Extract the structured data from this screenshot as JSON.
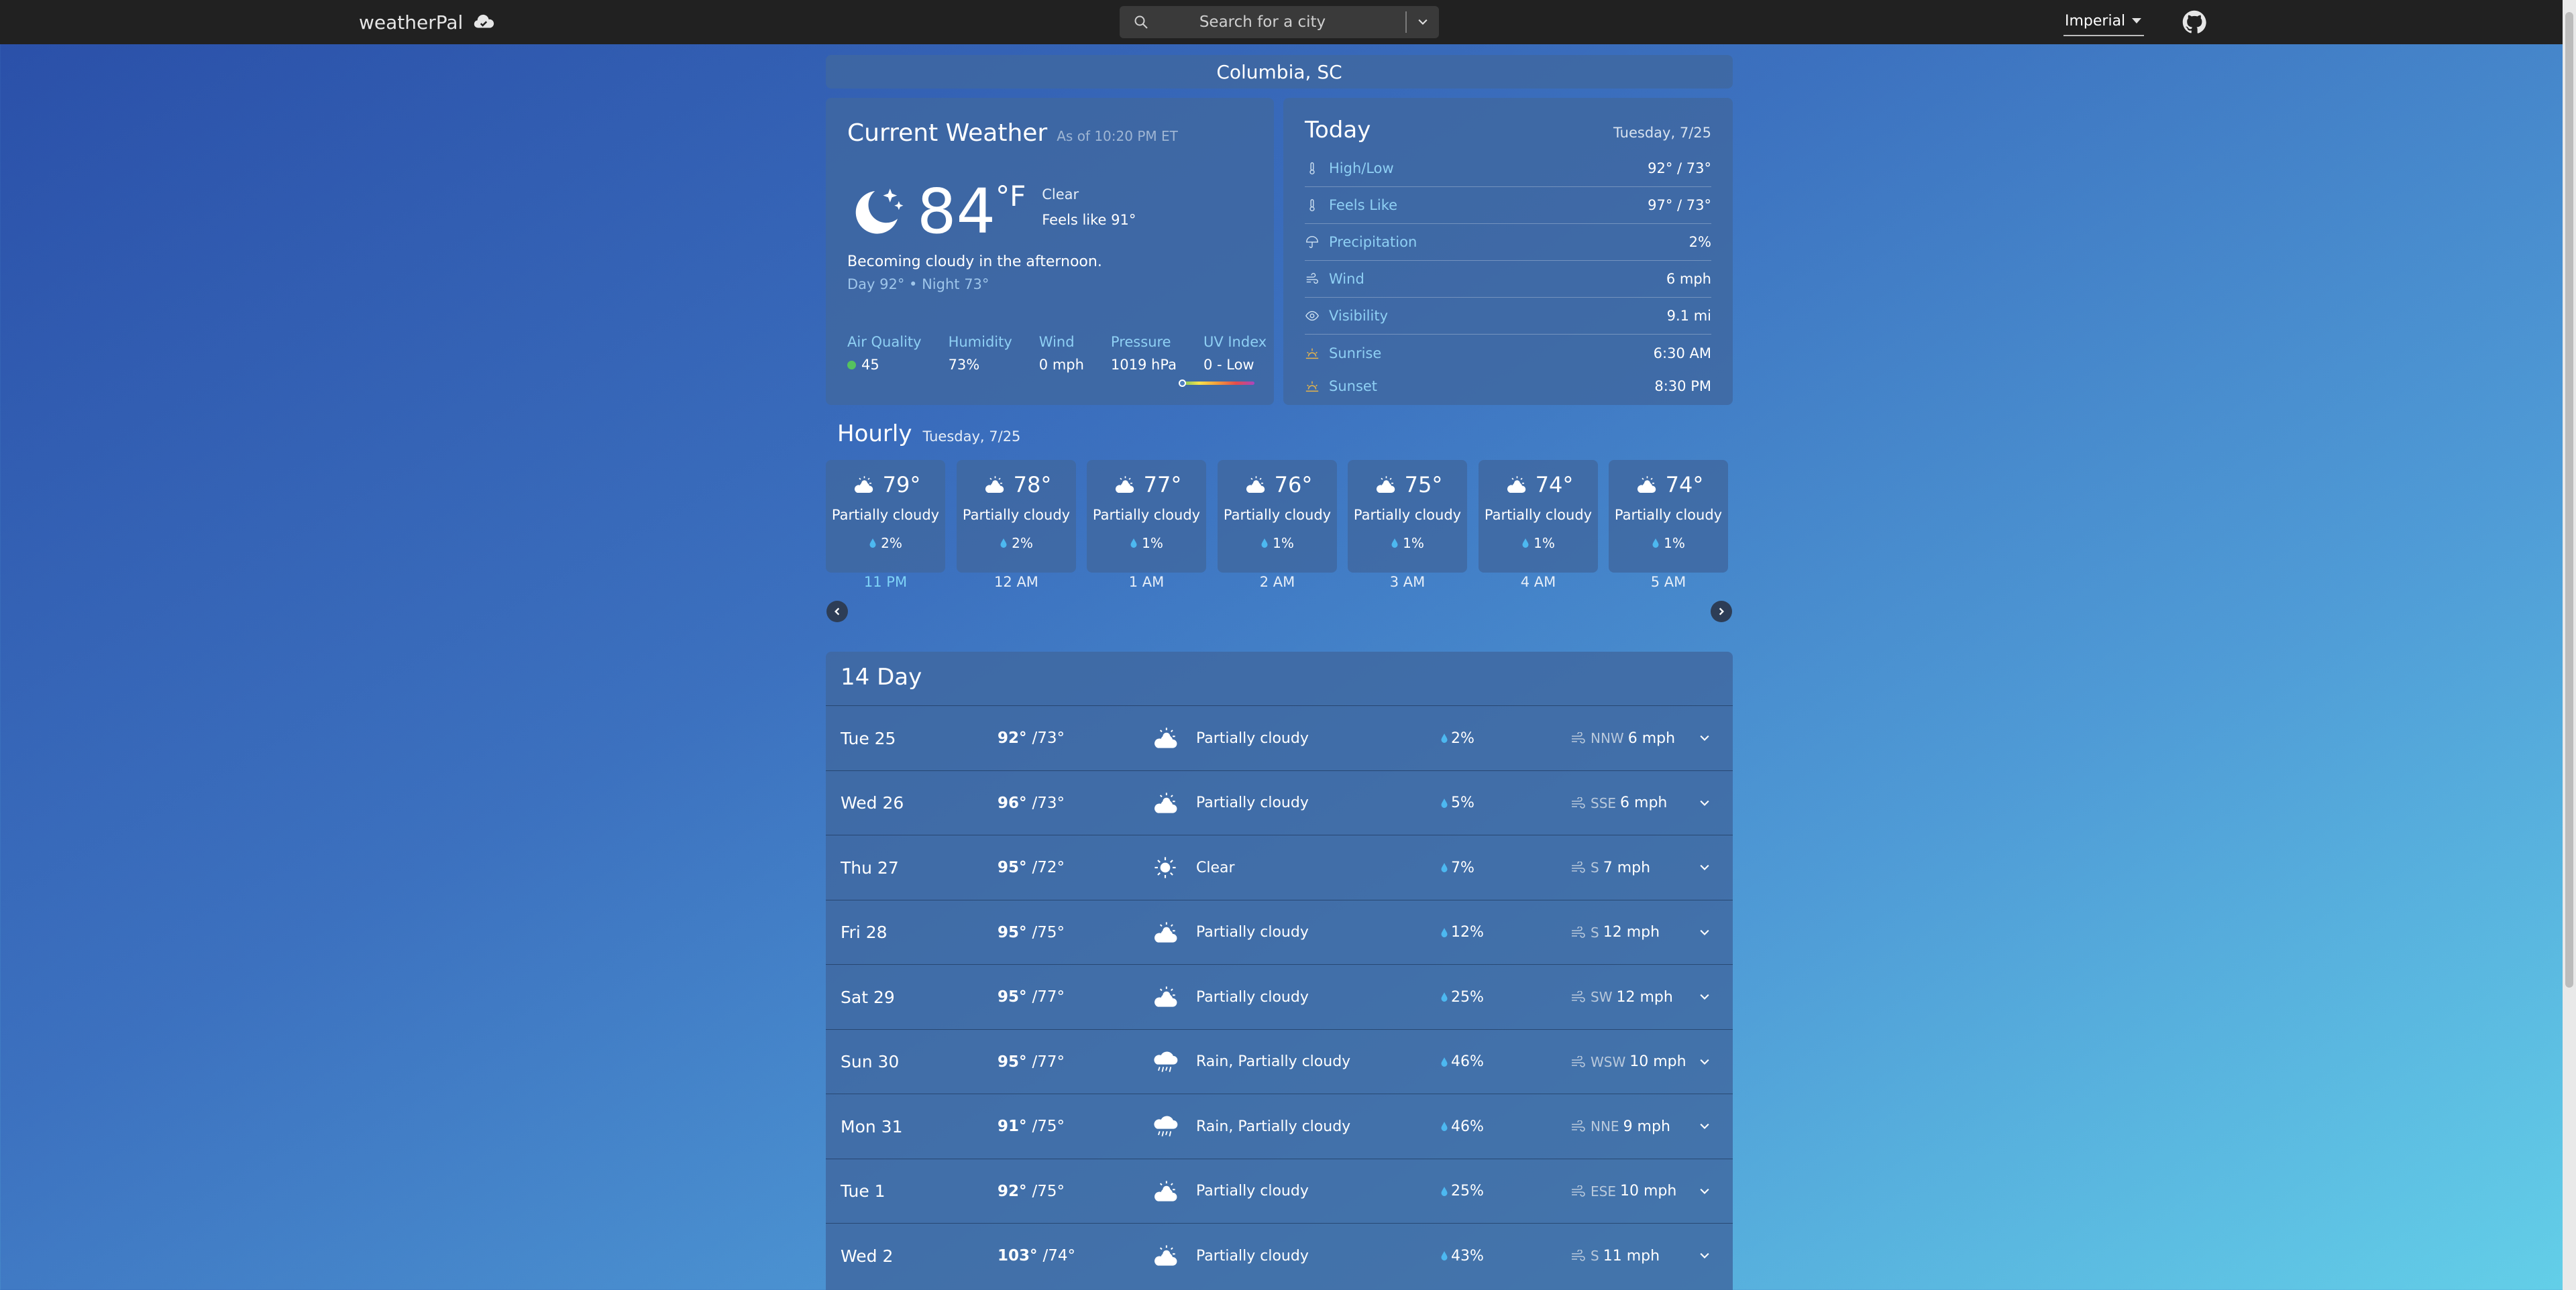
{
  "nav": {
    "brand": "weatherPal",
    "search_placeholder": "Search for a city",
    "units": "Imperial"
  },
  "location": "Columbia, SC",
  "current": {
    "title": "Current Weather",
    "as_of": "As of 10:20 PM ET",
    "temp": "84",
    "unit": "°F",
    "condition": "Clear",
    "feels_like": "Feels like 91°",
    "summary": "Becoming cloudy in the afternoon.",
    "day_night": "Day 92° • Night 73°",
    "stats": [
      {
        "label": "Air Quality",
        "value": "45"
      },
      {
        "label": "Humidity",
        "value": "73%"
      },
      {
        "label": "Wind",
        "value": "0 mph"
      },
      {
        "label": "Pressure",
        "value": "1019 hPa"
      },
      {
        "label": "UV Index",
        "value": "0 - Low"
      }
    ],
    "uv_level_fraction": 0
  },
  "today": {
    "title": "Today",
    "date": "Tuesday, 7/25",
    "rows": [
      {
        "label": "High/Low",
        "value": "92° / 73°",
        "icon": "thermometer-icon"
      },
      {
        "label": "Feels Like",
        "value": "97° / 73°",
        "icon": "thermometer-icon"
      },
      {
        "label": "Precipitation",
        "value": "2%",
        "icon": "umbrella-icon"
      },
      {
        "label": "Wind",
        "value": "6 mph",
        "icon": "wind-icon"
      },
      {
        "label": "Visibility",
        "value": "9.1 mi",
        "icon": "eye-icon"
      },
      {
        "label": "Sunrise",
        "value": "6:30 AM",
        "icon": "sunrise-icon"
      },
      {
        "label": "Sunset",
        "value": "8:30 PM",
        "icon": "sunset-icon"
      }
    ]
  },
  "hourly": {
    "title": "Hourly",
    "date": "Tuesday, 7/25",
    "hours": [
      {
        "temp": "79°",
        "cond": "Partially cloudy",
        "precip": "2%",
        "time": "11 PM"
      },
      {
        "temp": "78°",
        "cond": "Partially cloudy",
        "precip": "2%",
        "time": "12 AM"
      },
      {
        "temp": "77°",
        "cond": "Partially cloudy",
        "precip": "1%",
        "time": "1 AM"
      },
      {
        "temp": "76°",
        "cond": "Partially cloudy",
        "precip": "1%",
        "time": "2 AM"
      },
      {
        "temp": "75°",
        "cond": "Partially cloudy",
        "precip": "1%",
        "time": "3 AM"
      },
      {
        "temp": "74°",
        "cond": "Partially cloudy",
        "precip": "1%",
        "time": "4 AM"
      },
      {
        "temp": "74°",
        "cond": "Partially cloudy",
        "precip": "1%",
        "time": "5 AM"
      }
    ]
  },
  "forecast": {
    "title": "14 Day",
    "days": [
      {
        "day": "Tue 25",
        "high": "92°",
        "low": "/73°",
        "icon": "partly-cloudy-icon",
        "cond": "Partially cloudy",
        "precip": "2%",
        "dir": "NNW",
        "wind": "6 mph"
      },
      {
        "day": "Wed 26",
        "high": "96°",
        "low": "/73°",
        "icon": "partly-cloudy-icon",
        "cond": "Partially cloudy",
        "precip": "5%",
        "dir": "SSE",
        "wind": "6 mph"
      },
      {
        "day": "Thu 27",
        "high": "95°",
        "low": "/72°",
        "icon": "sun-icon",
        "cond": "Clear",
        "precip": "7%",
        "dir": "S",
        "wind": "7 mph"
      },
      {
        "day": "Fri 28",
        "high": "95°",
        "low": "/75°",
        "icon": "partly-cloudy-icon",
        "cond": "Partially cloudy",
        "precip": "12%",
        "dir": "S",
        "wind": "12 mph"
      },
      {
        "day": "Sat 29",
        "high": "95°",
        "low": "/77°",
        "icon": "partly-cloudy-icon",
        "cond": "Partially cloudy",
        "precip": "25%",
        "dir": "SW",
        "wind": "12 mph"
      },
      {
        "day": "Sun 30",
        "high": "95°",
        "low": "/77°",
        "icon": "rain-cloud-icon",
        "cond": "Rain, Partially cloudy",
        "precip": "46%",
        "dir": "WSW",
        "wind": "10 mph"
      },
      {
        "day": "Mon 31",
        "high": "91°",
        "low": "/75°",
        "icon": "rain-cloud-icon",
        "cond": "Rain, Partially cloudy",
        "precip": "46%",
        "dir": "NNE",
        "wind": "9 mph"
      },
      {
        "day": "Tue 1",
        "high": "92°",
        "low": "/75°",
        "icon": "partly-cloudy-icon",
        "cond": "Partially cloudy",
        "precip": "25%",
        "dir": "ESE",
        "wind": "10 mph"
      },
      {
        "day": "Wed 2",
        "high": "103°",
        "low": "/74°",
        "icon": "partly-cloudy-icon",
        "cond": "Partially cloudy",
        "precip": "43%",
        "dir": "S",
        "wind": "11 mph"
      }
    ]
  },
  "colors": {
    "navbar": "#212121",
    "panel": "#4068a0",
    "accent_label": "#8fd0f4",
    "air_quality_good": "#55c25e"
  }
}
